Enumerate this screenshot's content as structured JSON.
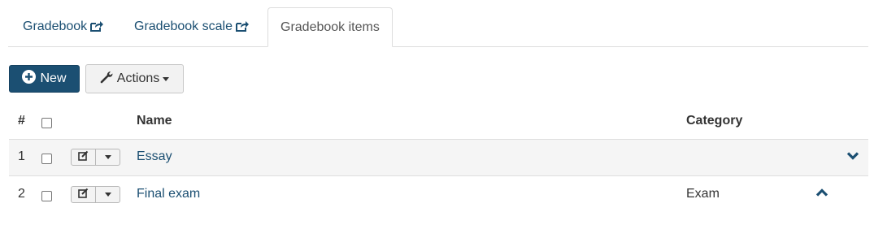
{
  "tabs": [
    {
      "label": "Gradebook",
      "icon": "external-link-icon",
      "active": false
    },
    {
      "label": "Gradebook scale",
      "icon": "external-link-icon",
      "active": true
    },
    {
      "label": "Gradebook items",
      "active": true
    }
  ],
  "toolbar": {
    "new_label": "New",
    "actions_label": "Actions"
  },
  "table": {
    "headers": {
      "number": "#",
      "name": "Name",
      "category": "Category"
    },
    "rows": [
      {
        "number": "1",
        "name": "Essay",
        "category": "",
        "toggle": "chevron-down-icon"
      },
      {
        "number": "2",
        "name": "Final exam",
        "category": "Exam",
        "toggle": "chevron-up-icon"
      }
    ]
  },
  "colors": {
    "primary": "#1b4f72",
    "tab_border": "#dddddd",
    "row_alt": "#f5f5f5"
  }
}
